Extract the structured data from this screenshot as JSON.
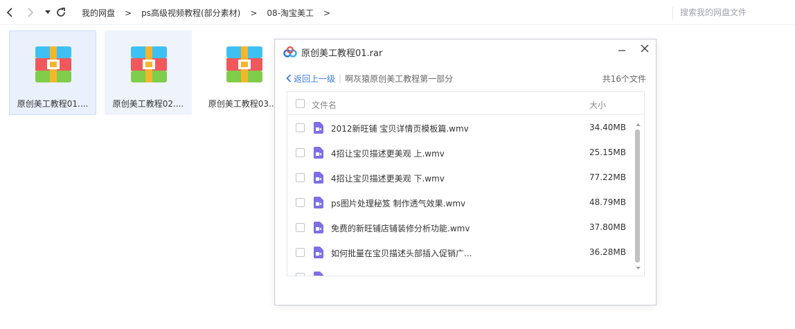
{
  "toolbar": {
    "breadcrumbs": [
      "我的网盘",
      "ps高级视频教程(部分素材)",
      "08-淘宝美工"
    ],
    "separator": ">",
    "search_placeholder": "搜索我的网盘文件"
  },
  "files": [
    {
      "name": "原创美工教程01....",
      "state": "selected"
    },
    {
      "name": "原创美工教程02....",
      "state": "hover"
    },
    {
      "name": "原创美工教程03....",
      "state": "normal"
    }
  ],
  "dialog": {
    "title": "原创美工教程01.rar",
    "back_label": "返回上一级",
    "path": "啊灰猿原创美工教程第一部分",
    "count": "共16个文件",
    "col_name": "文件名",
    "col_size": "大小",
    "rows": [
      {
        "name": "2012新旺铺 宝贝详情页模板篇.wmv",
        "size": "34.40MB"
      },
      {
        "name": "4招让宝贝描述更美观 上.wmv",
        "size": "25.15MB"
      },
      {
        "name": "4招让宝贝描述更美观 下.wmv",
        "size": "77.22MB"
      },
      {
        "name": "ps图片处理秘笈 制作透气效果.wmv",
        "size": "48.79MB"
      },
      {
        "name": "免费的新旺铺店铺装修分析功能.wmv",
        "size": "37.80MB"
      },
      {
        "name": "如何批量在宝贝描述头部插入促销广...",
        "size": "36.28MB"
      }
    ]
  },
  "icons": {
    "rar": "rar-archive-icon",
    "video": "video-file-icon"
  },
  "colors": {
    "accent": "#3e7bdc",
    "video_icon": "#7c6fe8",
    "selected_bg": "#eaf1fd"
  }
}
